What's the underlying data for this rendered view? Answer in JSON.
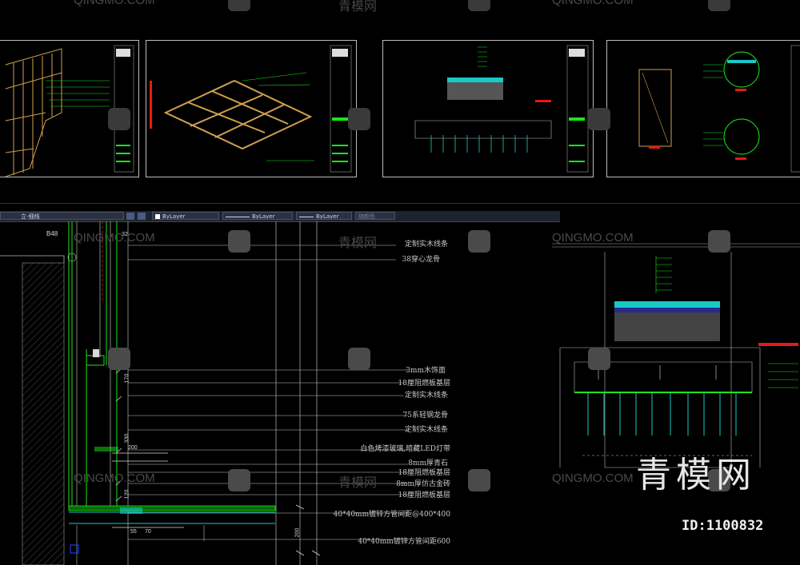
{
  "toolbar": {
    "layer_dropdown": "立-细线",
    "color_dropdown": "ByLayer",
    "linetype_dropdown": "ByLayer",
    "lineweight_dropdown": "ByLayer",
    "plotstyle_dropdown": "随颜色"
  },
  "detail": {
    "bubble_label": "B48",
    "labels": [
      "定制实木线条",
      "38穿心龙骨",
      "3mm木饰面",
      "18厘阻燃板基层",
      "定制实木线条",
      "75系轻钢龙骨",
      "定制实木线条",
      "白色烤漆玻璃,暗藏LED灯带",
      "8mm厚青石",
      "18厘阻燃板基层",
      "8mm厚仿古金砖",
      "18厘阻燃板基层",
      "40*40mm镀锌方管间距@400*400",
      "40*40mm镀锌方管间距600"
    ],
    "dims": [
      "32",
      "170",
      "330",
      "200",
      "120",
      "55",
      "70",
      "200"
    ]
  },
  "watermarks": {
    "latin": "QINGMO.COM",
    "cn": "青模网",
    "brand_large": "青模网",
    "id_text": "ID:1100832"
  },
  "colors": {
    "green": "#19e619",
    "cyan": "#19c8c8",
    "red": "#e61919",
    "orange": "#e6a032"
  }
}
